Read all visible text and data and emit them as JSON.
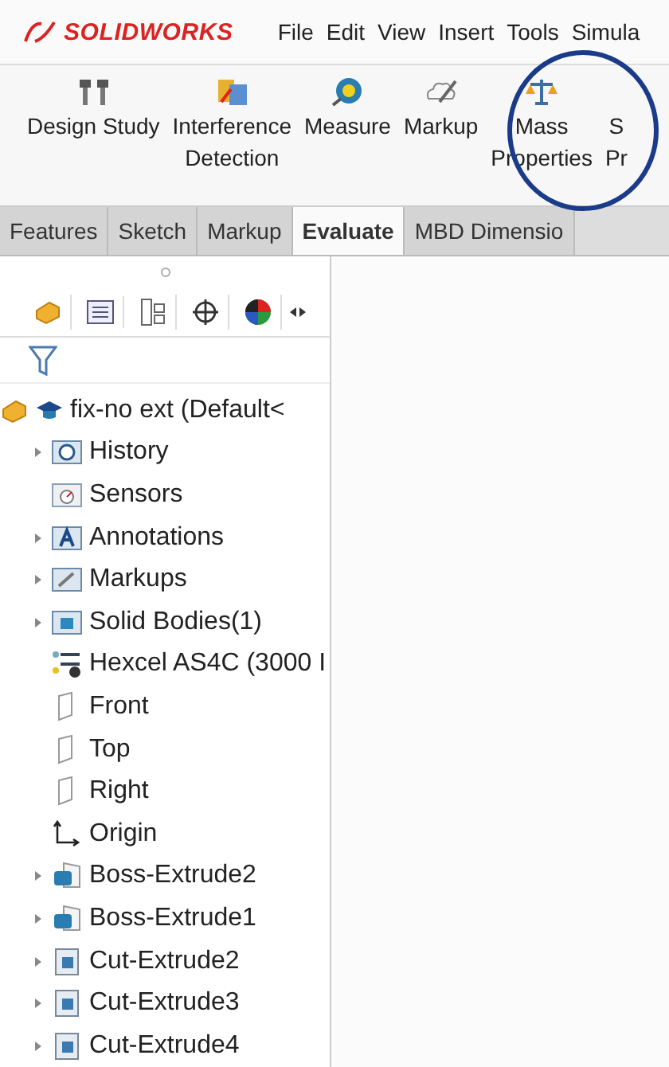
{
  "app": {
    "logo": "SOLIDWORKS"
  },
  "menu": [
    "File",
    "Edit",
    "View",
    "Insert",
    "Tools",
    "Simula"
  ],
  "toolbar": [
    {
      "kind": "design",
      "label": "Design Study"
    },
    {
      "kind": "interference",
      "label": "Interference",
      "sub": "Detection"
    },
    {
      "kind": "measure",
      "label": "Measure"
    },
    {
      "kind": "markup",
      "label": "Markup"
    },
    {
      "kind": "mass",
      "label": "Mass",
      "sub": "Properties",
      "highlighted": true
    },
    {
      "kind": "cut",
      "label": "S",
      "sub": "Pr"
    }
  ],
  "tabs": [
    {
      "label": "Features",
      "selected": false
    },
    {
      "label": "Sketch",
      "selected": false
    },
    {
      "label": "Markup",
      "selected": false
    },
    {
      "label": "Evaluate",
      "selected": true
    },
    {
      "label": "MBD Dimensio",
      "selected": false
    }
  ],
  "tree": {
    "label": "fix-no ext  (Default<",
    "children": [
      {
        "kind": "history",
        "label": "History",
        "expandable": true
      },
      {
        "kind": "sensors",
        "label": "Sensors",
        "expandable": false
      },
      {
        "kind": "annotations",
        "label": "Annotations",
        "expandable": true
      },
      {
        "kind": "markups",
        "label": "Markups",
        "expandable": true
      },
      {
        "kind": "bodies",
        "label": "Solid Bodies(1)",
        "expandable": true
      },
      {
        "kind": "material",
        "label": "Hexcel AS4C (3000 I",
        "expandable": false
      },
      {
        "kind": "plane",
        "label": "Front",
        "expandable": false
      },
      {
        "kind": "plane",
        "label": "Top",
        "expandable": false
      },
      {
        "kind": "plane",
        "label": "Right",
        "expandable": false
      },
      {
        "kind": "origin",
        "label": "Origin",
        "expandable": false
      },
      {
        "kind": "boss",
        "label": "Boss-Extrude2",
        "expandable": true
      },
      {
        "kind": "boss",
        "label": "Boss-Extrude1",
        "expandable": true
      },
      {
        "kind": "cut",
        "label": "Cut-Extrude2",
        "expandable": true
      },
      {
        "kind": "cut",
        "label": "Cut-Extrude3",
        "expandable": true
      },
      {
        "kind": "cut",
        "label": "Cut-Extrude4",
        "expandable": true
      }
    ]
  }
}
